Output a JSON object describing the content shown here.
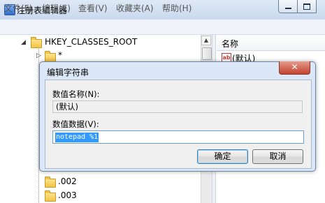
{
  "window": {
    "title": "注册表编辑器"
  },
  "menu": [
    "文件(F)",
    "编辑(E)",
    "查看(V)",
    "收藏夹(A)",
    "帮助(H)"
  ],
  "tree": {
    "root": "HKEY_CLASSES_ROOT",
    "items": [
      {
        "label": "*"
      },
      {
        "label": ".002"
      },
      {
        "label": ".003"
      }
    ]
  },
  "list": {
    "column_name": "名称",
    "rows": [
      {
        "name": "(默认)",
        "icon": "ab"
      }
    ]
  },
  "dialog": {
    "title": "编辑字符串",
    "close_label": "✕",
    "name_label": "数值名称(N):",
    "name_value": "(默认)",
    "data_label": "数值数据(V):",
    "data_value": "notepad %1",
    "ok_label": "确定",
    "cancel_label": "取消"
  }
}
